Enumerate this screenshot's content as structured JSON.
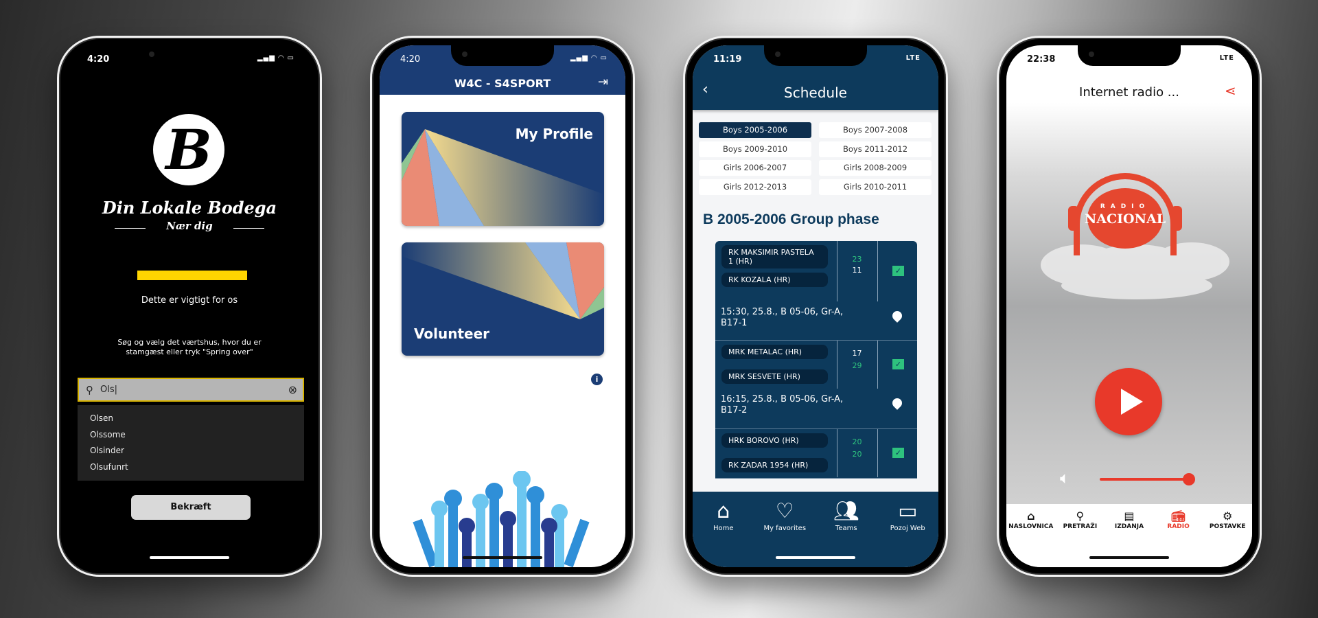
{
  "phones": [
    {
      "app": "Din Lokale Bodega",
      "status_time": "4:20",
      "logo_letter": "B",
      "title": "Din Lokale Bodega",
      "subtitle": "Nær dig",
      "progress_color": "#ffd500",
      "heading": "Dette er vigtigt for os",
      "instructions": "Søg og vælg det værtshus, hvor du er stamgæst eller tryk \"Spring over\"",
      "search": {
        "value": "Ols",
        "icon": "search-icon",
        "clear_icon": "clear-icon"
      },
      "suggestions": [
        "Olsen",
        "Olssome",
        "Olsinder",
        "Olsufunrt"
      ],
      "confirm_label": "Bekræft"
    },
    {
      "app": "W4C - S4SPORT",
      "status_time": "4:20",
      "header_title": "W4C - S4SPORT",
      "logout_icon": "logout-icon",
      "cards": [
        "My Profile",
        "Volunteer"
      ],
      "info_icon": "info-icon",
      "accent": "#1b3d75"
    },
    {
      "status_time": "11:19",
      "network": "LTE",
      "header_title": "Schedule",
      "tabs": [
        "Boys 2005-2006",
        "Boys 2007-2008",
        "Boys 2009-2010",
        "Boys 2011-2012",
        "Girls 2006-2007",
        "Girls 2008-2009",
        "Girls 2012-2013",
        "Girls 2010-2011"
      ],
      "active_tab": "Boys 2005-2006",
      "section_title": "B 2005-2006 Group phase",
      "matches": [
        {
          "home": "RK MAKSIMIR PASTELA 1 (HR)",
          "away": "RK KOZALA (HR)",
          "home_score": "23",
          "away_score": "11",
          "info": "15:30, 25.8., B 05-06, Gr-A, B17-1"
        },
        {
          "home": "MRK METALAC (HR)",
          "away": "MRK SESVETE (HR)",
          "home_score": "17",
          "away_score": "29",
          "info": "16:15, 25.8., B 05-06, Gr-A, B17-2"
        },
        {
          "home": "HRK BOROVO (HR)",
          "away": "RK ZADAR 1954 (HR)",
          "home_score": "20",
          "away_score": "20",
          "info": ""
        }
      ],
      "nav": [
        "Home",
        "My favorites",
        "Teams",
        "Pozoj Web"
      ],
      "accent": "#0d3a5c"
    },
    {
      "status_time": "22:38",
      "network": "LTE",
      "header_title": "Internet radio ...",
      "share_icon": "share-icon",
      "logo_top": "RADIO",
      "logo_main": "NACIONAL",
      "volume_percent": 95,
      "nav": [
        "NASLOVNICA",
        "PRETRAŽI",
        "IZDANJA",
        "RADIO",
        "POSTAVKE"
      ],
      "active_nav": "RADIO",
      "accent": "#e8392a"
    }
  ]
}
